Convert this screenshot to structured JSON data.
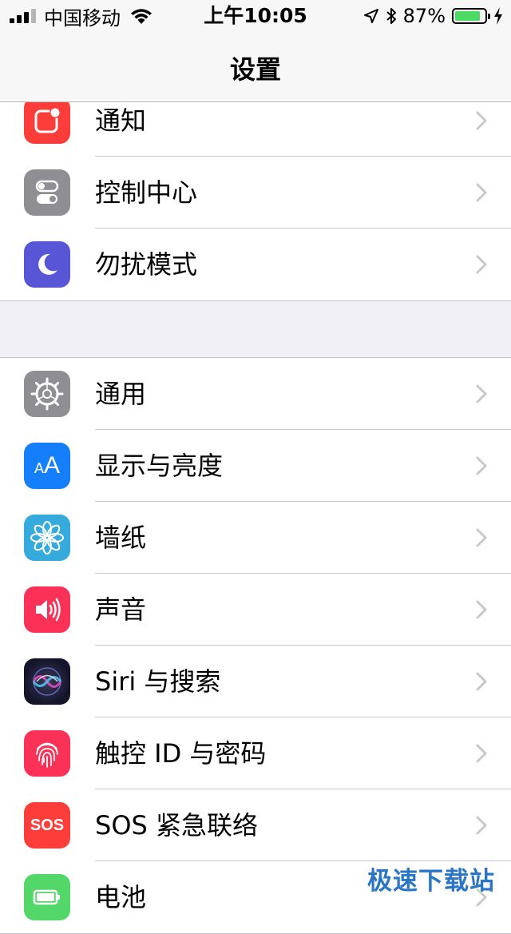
{
  "status_bar": {
    "carrier": "中国移动",
    "time": "上午10:05",
    "battery_percent": "87%",
    "battery_level": 0.87
  },
  "nav": {
    "title": "设置"
  },
  "groups": [
    {
      "items": [
        {
          "label": "通知",
          "icon": "notification-icon",
          "color": "#fc3d39"
        },
        {
          "label": "控制中心",
          "icon": "control-center-icon",
          "color": "#8e8e93"
        },
        {
          "label": "勿扰模式",
          "icon": "moon-icon",
          "color": "#5856d6"
        }
      ]
    },
    {
      "items": [
        {
          "label": "通用",
          "icon": "gear-icon",
          "color": "#8e8e93"
        },
        {
          "label": "显示与亮度",
          "icon": "display-brightness-icon",
          "color": "#147efb",
          "icon_text": "AA"
        },
        {
          "label": "墙纸",
          "icon": "wallpaper-icon",
          "color": "#35aadc"
        },
        {
          "label": "声音",
          "icon": "speaker-icon",
          "color": "#fc3158"
        },
        {
          "label": "Siri 与搜索",
          "icon": "siri-icon",
          "color": "#1b1b2e"
        },
        {
          "label": "触控 ID 与密码",
          "icon": "fingerprint-icon",
          "color": "#fc3158"
        },
        {
          "label": "SOS 紧急联络",
          "icon": "sos-icon",
          "color": "#fc3d39",
          "icon_text": "SOS"
        },
        {
          "label": "电池",
          "icon": "battery-icon",
          "color": "#53d769"
        }
      ]
    }
  ],
  "watermark": "极速下载站"
}
